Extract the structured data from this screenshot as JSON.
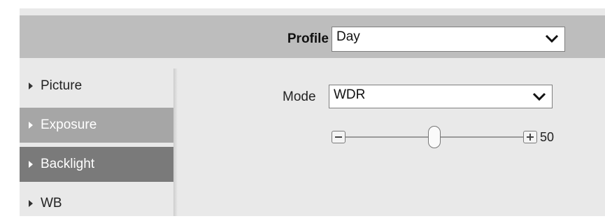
{
  "profile": {
    "label": "Profile",
    "selected": "Day"
  },
  "sidebar": {
    "items": [
      {
        "label": "Picture",
        "state": "normal"
      },
      {
        "label": "Exposure",
        "state": "hover"
      },
      {
        "label": "Backlight",
        "state": "selected"
      },
      {
        "label": "WB",
        "state": "normal"
      }
    ]
  },
  "backlight": {
    "mode_label": "Mode",
    "mode_selected": "WDR",
    "level": {
      "value": "50",
      "min": 0,
      "max": 100,
      "current": 50
    }
  },
  "icons": {
    "dropdown": "chevron-down-icon",
    "expand": "triangle-right-icon",
    "decrease": "minus-icon",
    "increase": "plus-icon"
  },
  "colors": {
    "header_bar": "#bdbdbd",
    "panel_bg": "#e9e9e9",
    "hover_item": "#a6a6a6",
    "selected_item": "#7a7a7a"
  }
}
